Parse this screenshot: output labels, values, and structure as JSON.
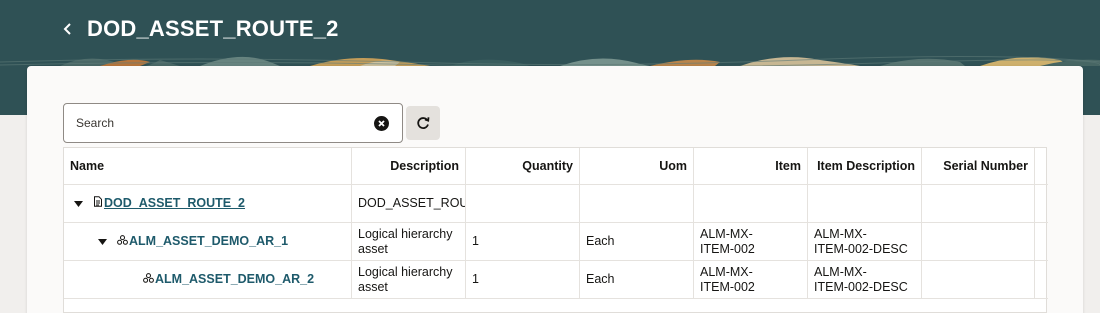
{
  "page": {
    "title": "DOD_ASSET_ROUTE_2"
  },
  "toolbar": {
    "search_placeholder": "Search"
  },
  "table": {
    "columns": [
      "Name",
      "Description",
      "Quantity",
      "Uom",
      "Item",
      "Item Description",
      "Serial Number"
    ],
    "rows": [
      {
        "name": "DOD_ASSET_ROUTE_2",
        "description": "DOD_ASSET_ROUT",
        "quantity": "",
        "uom": "",
        "item": "",
        "item_description": "",
        "serial_number": ""
      },
      {
        "name": "ALM_ASSET_DEMO_AR_1",
        "description_line1": "Logical hierarchy",
        "description_line2": "asset",
        "quantity": "1",
        "uom": "Each",
        "item_line1": "ALM-MX-",
        "item_line2": "ITEM-002",
        "item_description_line1": "ALM-MX-",
        "item_description_line2": "ITEM-002-DESC",
        "serial_number": ""
      },
      {
        "name": "ALM_ASSET_DEMO_AR_2",
        "description_line1": "Logical hierarchy",
        "description_line2": "asset",
        "quantity": "1",
        "uom": "Each",
        "item_line1": "ALM-MX-",
        "item_line2": "ITEM-002",
        "item_description_line1": "ALM-MX-",
        "item_description_line2": "ITEM-002-DESC",
        "serial_number": ""
      }
    ]
  },
  "icons": {
    "back": "chevron-left-icon",
    "clear": "clear-icon",
    "refresh": "refresh-icon",
    "expand": "caret-down-icon",
    "route": "document-icon",
    "asset": "asset-hierarchy-icon"
  },
  "colors": {
    "header_bg": "#2f5155",
    "link": "#1e5a6b",
    "page_bg": "#f1efed"
  }
}
